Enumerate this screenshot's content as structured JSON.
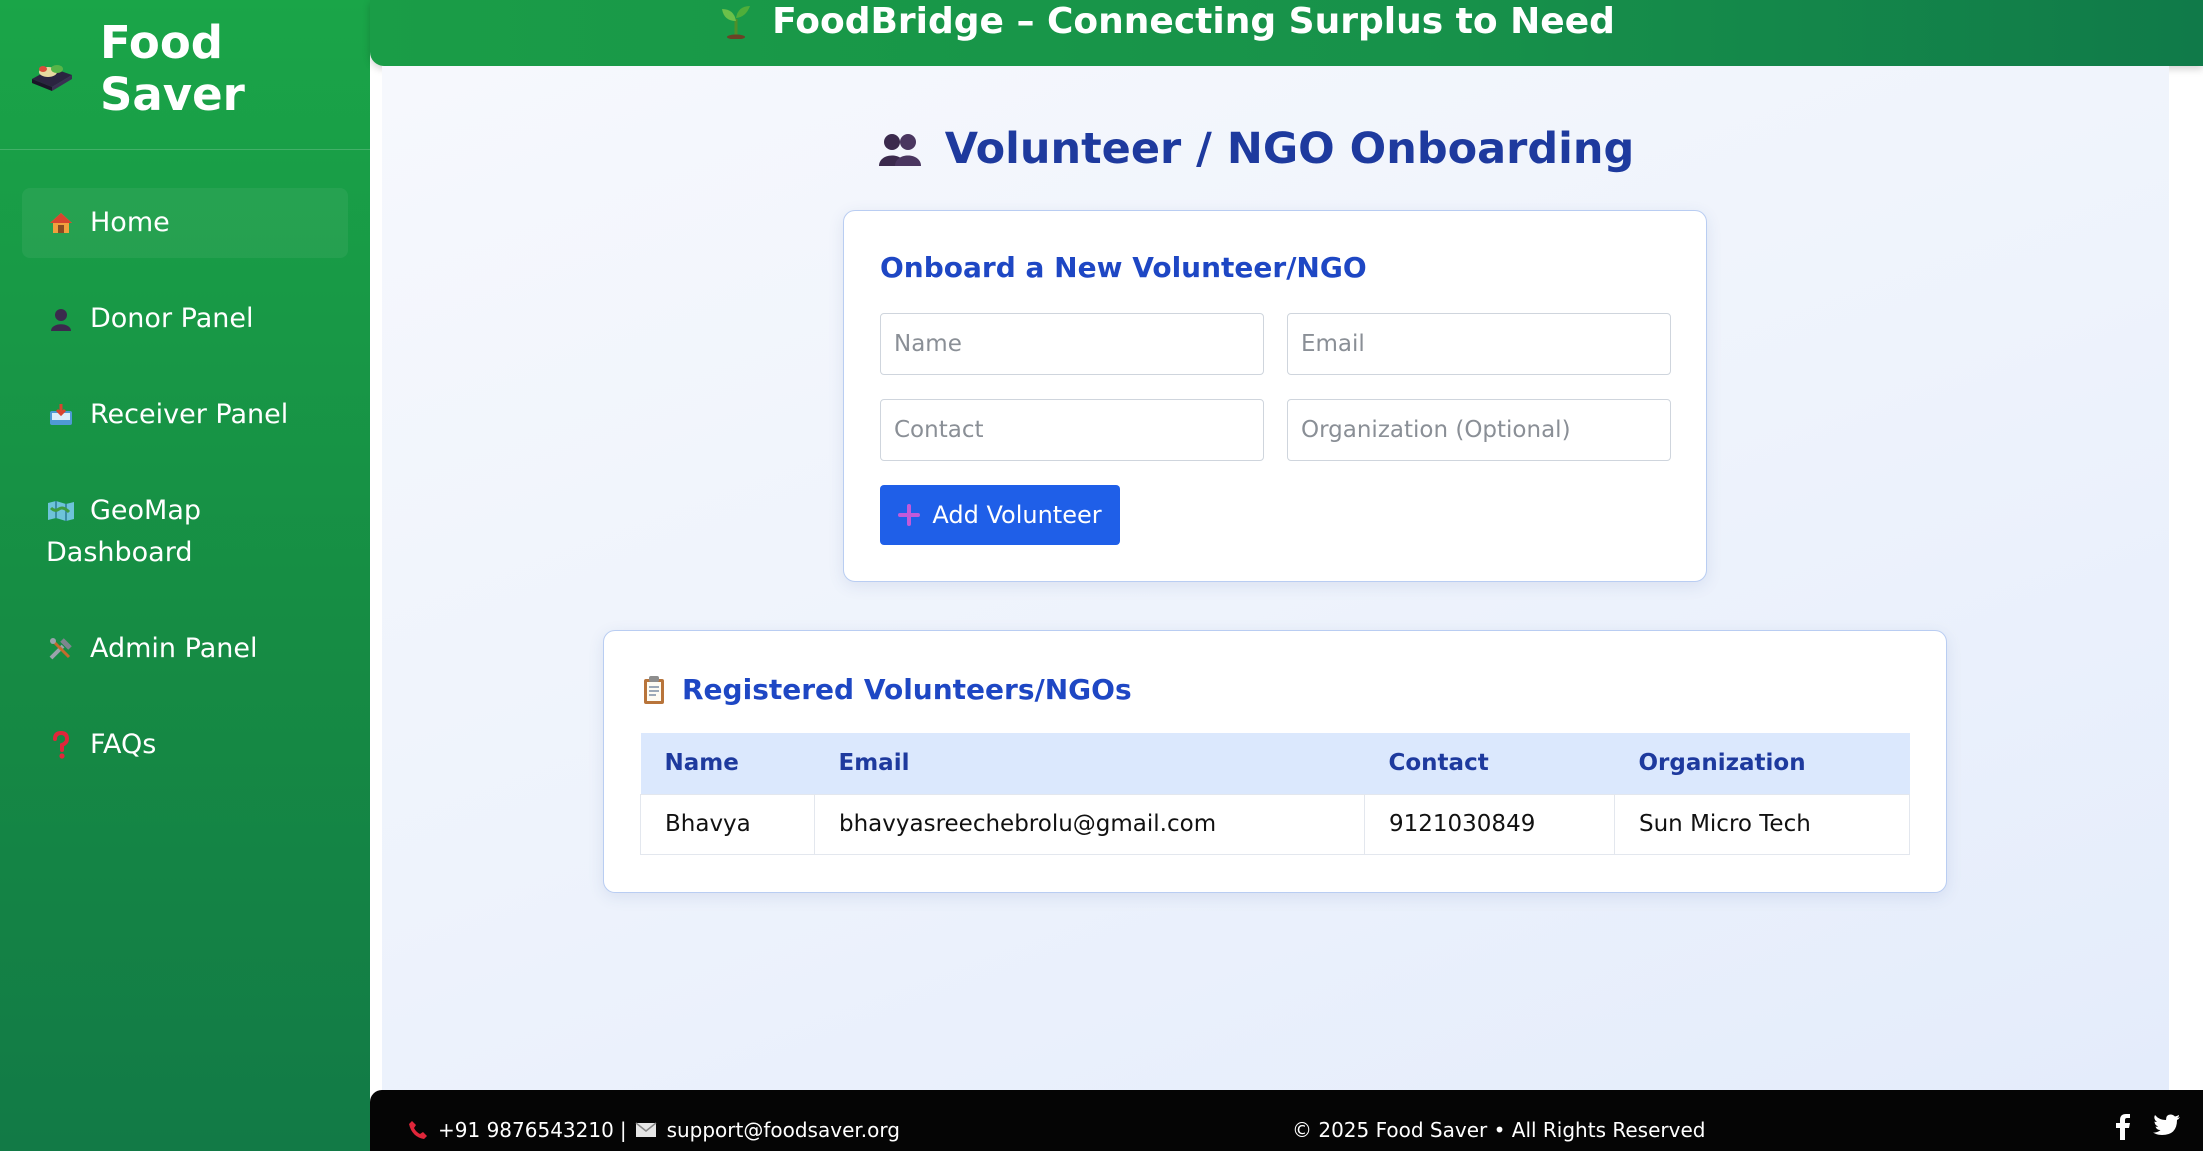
{
  "brand": {
    "name": "Food\nSaver",
    "icon": "food-tray-icon"
  },
  "sidebar": {
    "items": [
      {
        "label": "Home",
        "icon": "house-icon",
        "active": true
      },
      {
        "label": "Donor Panel",
        "icon": "person-icon"
      },
      {
        "label": "Receiver Panel",
        "icon": "inbox-tray-icon"
      },
      {
        "label": "GeoMap Dashboard",
        "icon": "map-icon"
      },
      {
        "label": "Admin Panel",
        "icon": "tools-icon"
      },
      {
        "label": "FAQs",
        "icon": "question-icon"
      }
    ]
  },
  "header": {
    "title": "FoodBridge – Connecting Surplus to Need",
    "icon": "seedling-icon"
  },
  "page": {
    "title": "Volunteer / NGO Onboarding",
    "icon": "people-icon"
  },
  "form": {
    "title": "Onboard a New Volunteer/NGO",
    "name_placeholder": "Name",
    "email_placeholder": "Email",
    "contact_placeholder": "Contact",
    "org_placeholder": "Organization (Optional)",
    "submit_label": "Add Volunteer"
  },
  "list": {
    "title": "Registered Volunteers/NGOs",
    "columns": [
      "Name",
      "Email",
      "Contact",
      "Organization"
    ],
    "rows": [
      [
        "Bhavya",
        "bhavyasreechebrolu@gmail.com",
        "9121030849",
        "Sun Micro Tech"
      ]
    ]
  },
  "footer": {
    "phone": "+91 9876543210",
    "separator": "|",
    "email": "support@foodsaver.org",
    "copyright": "© 2025 Food Saver • All Rights Reserved"
  },
  "colors": {
    "sidebar_green": "#1aa548",
    "title_blue": "#1e3a9e",
    "button_blue": "#1f5fe8",
    "table_header_bg": "#dbe8fd"
  }
}
